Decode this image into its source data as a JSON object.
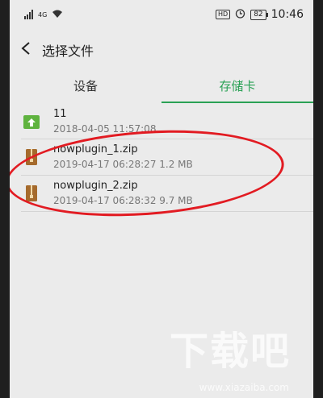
{
  "status_bar": {
    "signal_label": "4G",
    "hd_label": "HD",
    "battery": "82",
    "time": "10:46"
  },
  "app_bar": {
    "back_icon": "back-arrow",
    "title": "选择文件"
  },
  "tabs": [
    {
      "label": "设备",
      "active": false
    },
    {
      "label": "存储卡",
      "active": true
    }
  ],
  "files": [
    {
      "name": "11",
      "meta": "2018-04-05 11:57:08",
      "icon": "folder-up-icon"
    },
    {
      "name": "nowplugin_1.zip",
      "meta": "2019-04-17 06:28:27  1.2 MB",
      "icon": "zip-icon"
    },
    {
      "name": "nowplugin_2.zip",
      "meta": "2019-04-17 06:28:32  9.7 MB",
      "icon": "zip-icon"
    }
  ],
  "watermark": {
    "text": "下载吧",
    "url": "www.xiazaiba.com"
  }
}
